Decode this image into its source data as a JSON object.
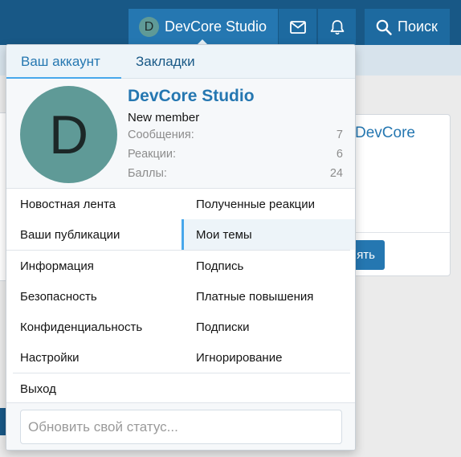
{
  "nav": {
    "username": "DevCore Studio",
    "avatar_letter": "D",
    "search_label": "Поиск",
    "icons": [
      "envelope-icon",
      "bell-icon",
      "search-icon"
    ]
  },
  "background": {
    "panel_title": "DevCore",
    "button_label": "ять"
  },
  "menu": {
    "tabs": [
      {
        "label": "Ваш аккаунт",
        "active": true
      },
      {
        "label": "Закладки",
        "active": false
      }
    ],
    "profile": {
      "avatar_letter": "D",
      "name": "DevCore Studio",
      "title": "New member",
      "stats": [
        {
          "label": "Сообщения:",
          "value": "7"
        },
        {
          "label": "Реакции:",
          "value": "6"
        },
        {
          "label": "Баллы:",
          "value": "24"
        }
      ]
    },
    "links": {
      "news_feed": "Новостная лента",
      "received_reactions": "Полученные реакции",
      "your_posts": "Ваши публикации",
      "my_threads": "Мои темы",
      "information": "Информация",
      "signature": "Подпись",
      "security": "Безопасность",
      "paid_upgrades": "Платные повышения",
      "privacy": "Конфиденциальность",
      "subscriptions": "Подписки",
      "settings": "Настройки",
      "ignoring": "Игнорирование",
      "logout": "Выход"
    },
    "status_placeholder": "Обновить свой статус..."
  },
  "colors": {
    "header": "#185886",
    "accent": "#2577b1",
    "tab_underline": "#47a7eb",
    "avatar": "#5f9a97"
  }
}
